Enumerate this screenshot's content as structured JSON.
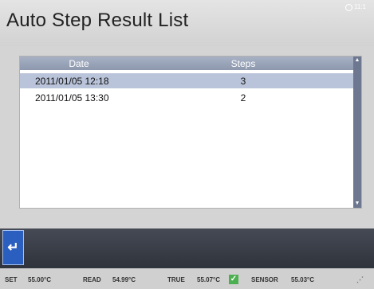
{
  "header": {
    "title": "Auto Step Result List",
    "clock": "11:1"
  },
  "table": {
    "columns": [
      "Date",
      "Steps"
    ],
    "rows": [
      {
        "date": "2011/01/05 12:18",
        "steps": "3",
        "selected": true
      },
      {
        "date": "2011/01/05 13:30",
        "steps": "2",
        "selected": false
      }
    ]
  },
  "icons": {
    "back": "return-arrow-icon",
    "check": "check-icon",
    "clock": "clock-icon",
    "signal": "signal-icon"
  },
  "status": {
    "set_label": "SET",
    "set_value": "55.00°C",
    "read_label": "READ",
    "read_value": "54.99°C",
    "true_label": "TRUE",
    "true_value": "55.07°C",
    "sensor_label": "SENSOR",
    "sensor_value": "55.03°C"
  },
  "colors": {
    "selection": "#b9c3d9",
    "header": "#8d98ae",
    "back_button": "#2a5fc0",
    "check": "#4caf50"
  }
}
